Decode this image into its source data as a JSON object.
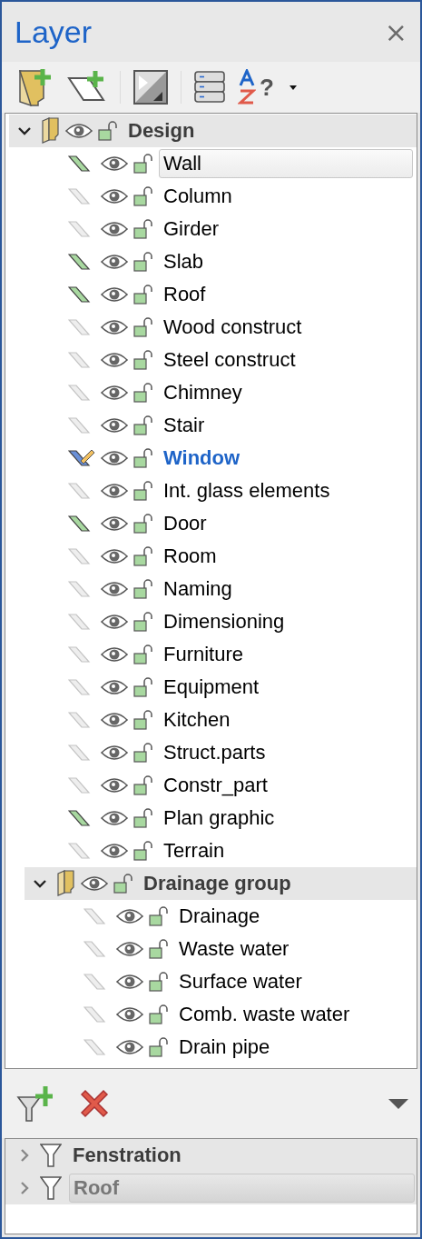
{
  "panel": {
    "title": "Layer",
    "close": "×"
  },
  "toolbar": {
    "sort_label": "?"
  },
  "tree": [
    {
      "kind": "group",
      "name": "Design",
      "expanded": true,
      "selected": false,
      "children": [
        {
          "kind": "layer",
          "name": "Wall",
          "filled": true,
          "current": false,
          "selected": true
        },
        {
          "kind": "layer",
          "name": "Column",
          "filled": false,
          "current": false,
          "selected": false
        },
        {
          "kind": "layer",
          "name": "Girder",
          "filled": false,
          "current": false,
          "selected": false
        },
        {
          "kind": "layer",
          "name": "Slab",
          "filled": true,
          "current": false,
          "selected": false
        },
        {
          "kind": "layer",
          "name": "Roof",
          "filled": true,
          "current": false,
          "selected": false
        },
        {
          "kind": "layer",
          "name": "Wood construct",
          "filled": false,
          "current": false,
          "selected": false
        },
        {
          "kind": "layer",
          "name": "Steel construct",
          "filled": false,
          "current": false,
          "selected": false
        },
        {
          "kind": "layer",
          "name": "Chimney",
          "filled": false,
          "current": false,
          "selected": false
        },
        {
          "kind": "layer",
          "name": "Stair",
          "filled": false,
          "current": false,
          "selected": false
        },
        {
          "kind": "layer",
          "name": "Window",
          "filled": true,
          "current": true,
          "selected": false
        },
        {
          "kind": "layer",
          "name": "Int. glass elements",
          "filled": false,
          "current": false,
          "selected": false
        },
        {
          "kind": "layer",
          "name": "Door",
          "filled": true,
          "current": false,
          "selected": false
        },
        {
          "kind": "layer",
          "name": "Room",
          "filled": false,
          "current": false,
          "selected": false
        },
        {
          "kind": "layer",
          "name": "Naming",
          "filled": false,
          "current": false,
          "selected": false
        },
        {
          "kind": "layer",
          "name": "Dimensioning",
          "filled": false,
          "current": false,
          "selected": false
        },
        {
          "kind": "layer",
          "name": "Furniture",
          "filled": false,
          "current": false,
          "selected": false
        },
        {
          "kind": "layer",
          "name": "Equipment",
          "filled": false,
          "current": false,
          "selected": false
        },
        {
          "kind": "layer",
          "name": "Kitchen",
          "filled": false,
          "current": false,
          "selected": false
        },
        {
          "kind": "layer",
          "name": "Struct.parts",
          "filled": false,
          "current": false,
          "selected": false
        },
        {
          "kind": "layer",
          "name": "Constr_part",
          "filled": false,
          "current": false,
          "selected": false
        },
        {
          "kind": "layer",
          "name": "Plan graphic",
          "filled": true,
          "current": false,
          "selected": false
        },
        {
          "kind": "layer",
          "name": "Terrain",
          "filled": false,
          "current": false,
          "selected": false
        },
        {
          "kind": "group",
          "name": "Drainage group",
          "expanded": true,
          "selected": false,
          "children": [
            {
              "kind": "layer",
              "name": "Drainage",
              "filled": false,
              "current": false,
              "selected": false
            },
            {
              "kind": "layer",
              "name": "Waste water",
              "filled": false,
              "current": false,
              "selected": false
            },
            {
              "kind": "layer",
              "name": "Surface water",
              "filled": false,
              "current": false,
              "selected": false
            },
            {
              "kind": "layer",
              "name": "Comb. waste water",
              "filled": false,
              "current": false,
              "selected": false
            },
            {
              "kind": "layer",
              "name": "Drain pipe",
              "filled": false,
              "current": false,
              "selected": false
            }
          ]
        }
      ]
    }
  ],
  "filters": [
    {
      "name": "Fenstration",
      "expanded": false,
      "selected": false
    },
    {
      "name": "Roof",
      "expanded": false,
      "selected": true
    }
  ]
}
